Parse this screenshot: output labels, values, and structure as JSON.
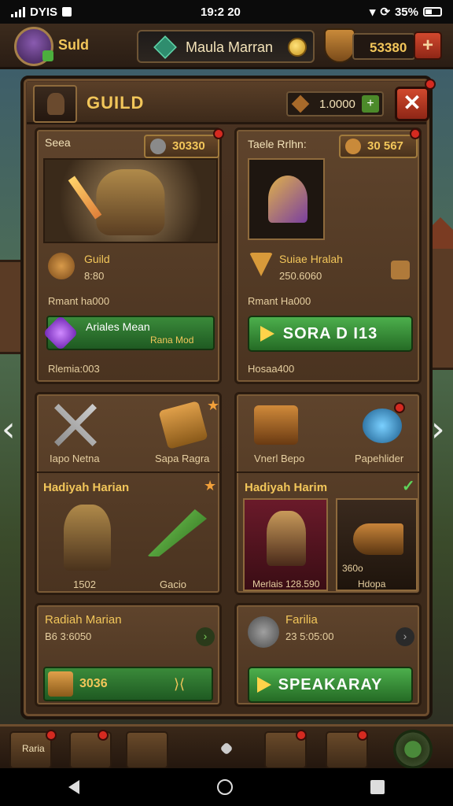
{
  "status": {
    "carrier": "DYIS",
    "time": "19:2 20",
    "battery": "35%"
  },
  "hud": {
    "player_name": "Suld",
    "guild_pill_label": "Maula Marran",
    "gold_amount": "53380",
    "plus_label": "+"
  },
  "panel": {
    "title": "GUILD",
    "resource_amount": "1.0000",
    "resource_plus": "+",
    "close_label": "✕"
  },
  "card_featured": {
    "title": "Seea",
    "price": "30330",
    "item_name": "Guild",
    "item_value": "8:80",
    "label_a": "Rmant ha000",
    "bar_title": "Ariales Mean",
    "bar_tag": "Rana Mod",
    "footer": "Rlemia:003"
  },
  "card_item": {
    "title": "Taele Rrlhn:",
    "price": "30 567",
    "item_name": "Suiae Hralah",
    "item_value": "250.6060",
    "label_a": "Rmant Ha000",
    "button_label": "SORA D I13",
    "footer": "Hosaa400"
  },
  "grid_left": {
    "left_label": "Iapo Netna",
    "right_label": "Sapa Ragra",
    "section_title": "Hadiyah Harian",
    "hero_value": "1502",
    "weapon_value": "Gacio"
  },
  "grid_right": {
    "left_label": "Vnerl Bepo",
    "right_label": "Papehlider",
    "section_title": "Hadiyah Harim",
    "hero_value": "Merlais 128.590",
    "item_value": "Hdopa",
    "item_sub": "360o"
  },
  "bottom_left": {
    "title": "Radiah Marian",
    "value": "B6 3:6050",
    "bar_value": "3036"
  },
  "bottom_right": {
    "title": "Farilia",
    "value": "23 5:05:00",
    "button_label": "SPEAKARAY"
  },
  "toolbar": {
    "first_label": "Raria"
  },
  "colors": {
    "gold": "#f2c65a",
    "green": "#4caf4c",
    "red": "#d1492e",
    "wood": "#4a3322"
  }
}
